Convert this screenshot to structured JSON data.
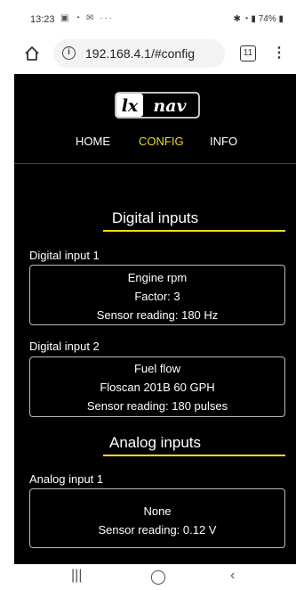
{
  "status_bar": {
    "time": "13:23",
    "battery": "74%"
  },
  "browser": {
    "url": "192.168.4.1/#config",
    "tab_count": "11"
  },
  "site": {
    "logo_text": "lxnav",
    "nav": [
      {
        "label": "HOME"
      },
      {
        "label": "CONFIG"
      },
      {
        "label": "INFO"
      }
    ],
    "active_nav": "CONFIG"
  },
  "digital": {
    "title": "Digital inputs",
    "inputs": [
      {
        "label": "Digital input 1",
        "lines": [
          "Engine rpm",
          "Factor: 3",
          "Sensor reading: 180 Hz"
        ]
      },
      {
        "label": "Digital input 2",
        "lines": [
          "Fuel flow",
          "Floscan 201B 60 GPH",
          "Sensor reading: 180 pulses"
        ]
      }
    ]
  },
  "analog": {
    "title": "Analog inputs",
    "inputs": [
      {
        "label": "Analog input 1",
        "lines": [
          "None",
          "Sensor reading: 0.12 V"
        ]
      }
    ]
  },
  "colors": {
    "accent": "#f2da1a",
    "page_bg": "#000000"
  }
}
